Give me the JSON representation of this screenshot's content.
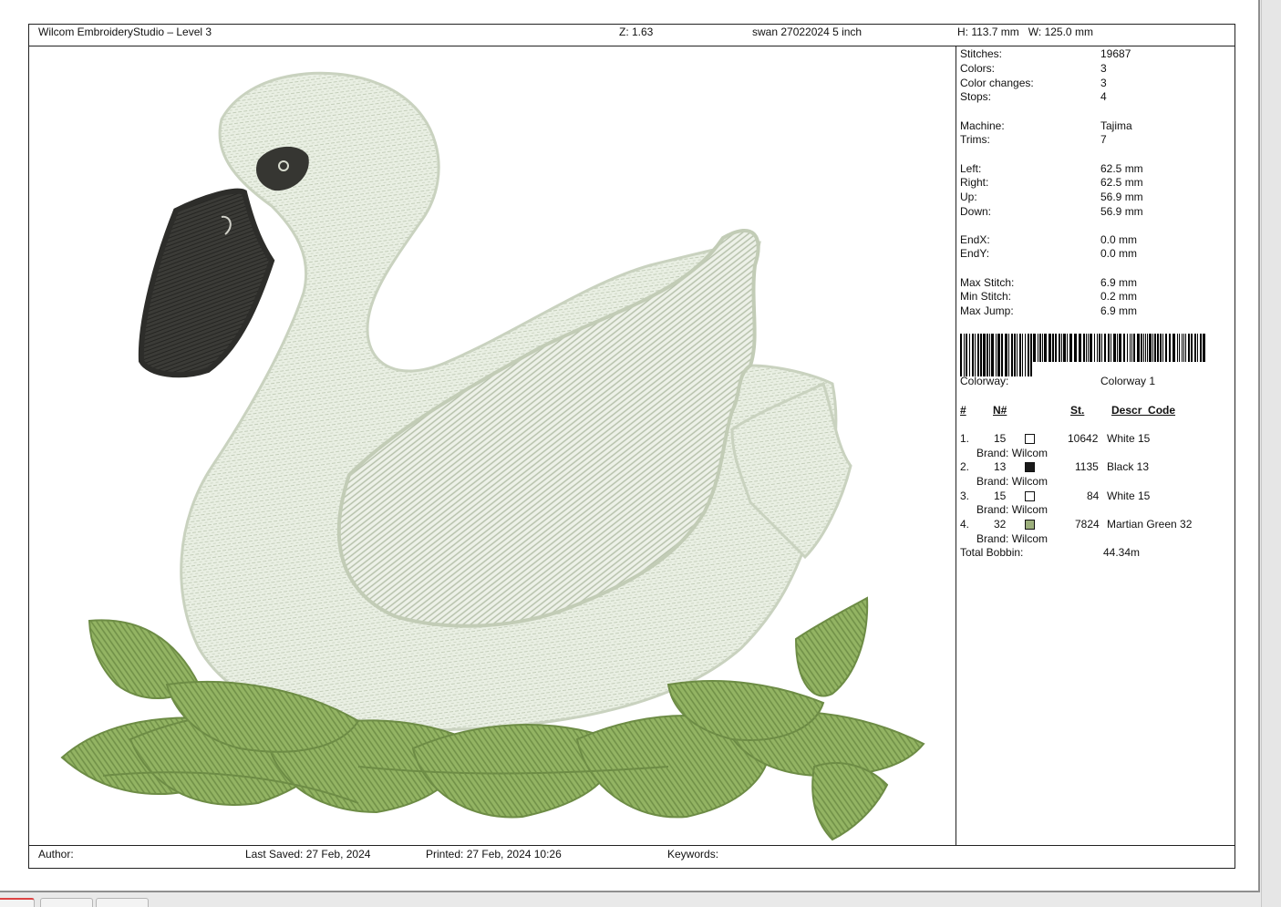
{
  "header": {
    "app_title": "Wilcom EmbroideryStudio – Level 3",
    "zoom": "Z: 1.63",
    "design_name": "swan 27022024 5 inch",
    "size": "H: 113.7 mm   W: 125.0 mm"
  },
  "stats": [
    {
      "label": "Stitches:",
      "value": "19687"
    },
    {
      "label": "Colors:",
      "value": "3"
    },
    {
      "label": "Color changes:",
      "value": "3"
    },
    {
      "label": "Stops:",
      "value": "4"
    },
    {
      "label": "Machine:",
      "value": "Tajima"
    },
    {
      "label": "Trims:",
      "value": "7"
    },
    {
      "label": "Left:",
      "value": "62.5 mm"
    },
    {
      "label": "Right:",
      "value": "62.5 mm"
    },
    {
      "label": "Up:",
      "value": "56.9 mm"
    },
    {
      "label": "Down:",
      "value": "56.9 mm"
    },
    {
      "label": "EndX:",
      "value": "0.0 mm"
    },
    {
      "label": "EndY:",
      "value": "0.0 mm"
    },
    {
      "label": "Max Stitch:",
      "value": "6.9 mm"
    },
    {
      "label": "Min Stitch:",
      "value": "0.2 mm"
    },
    {
      "label": "Max Jump:",
      "value": "6.9 mm"
    }
  ],
  "colorway": {
    "label": "Colorway:",
    "value": "Colorway 1"
  },
  "color_table": {
    "headers": {
      "num": "#",
      "n": "N#",
      "st": "St.",
      "descr": "Descr_Code"
    },
    "rows": [
      {
        "idx": "1.",
        "n": "15",
        "swatch": "#ffffff",
        "st": "10642",
        "descr": "White 15",
        "brand": "Brand: Wilcom"
      },
      {
        "idx": "2.",
        "n": "13",
        "swatch": "#1a1a1a",
        "st": "1135",
        "descr": "Black 13",
        "brand": "Brand: Wilcom"
      },
      {
        "idx": "3.",
        "n": "15",
        "swatch": "#ffffff",
        "st": "84",
        "descr": "White 15",
        "brand": "Brand: Wilcom"
      },
      {
        "idx": "4.",
        "n": "32",
        "swatch": "#9caf7c",
        "st": "7824",
        "descr": "Martian Green 32",
        "brand": "Brand: Wilcom"
      }
    ],
    "total_bobbin": {
      "label": "Total Bobbin:",
      "value": "44.34m"
    }
  },
  "footer": {
    "author": "Author:",
    "last_saved": "Last Saved: 27 Feb, 2024",
    "printed": "Printed: 27 Feb, 2024 10:26",
    "keywords": "Keywords:"
  },
  "colors": {
    "swan_body": "#e8eee2",
    "swan_stitch": "#b9c4b0",
    "beak": "#3a3a36",
    "leaves": "#8fb05f",
    "leaves_dark": "#6d8c45"
  },
  "design_image": {
    "icons": [
      "swan-embroidery",
      "leaf-nest-embroidery"
    ]
  }
}
